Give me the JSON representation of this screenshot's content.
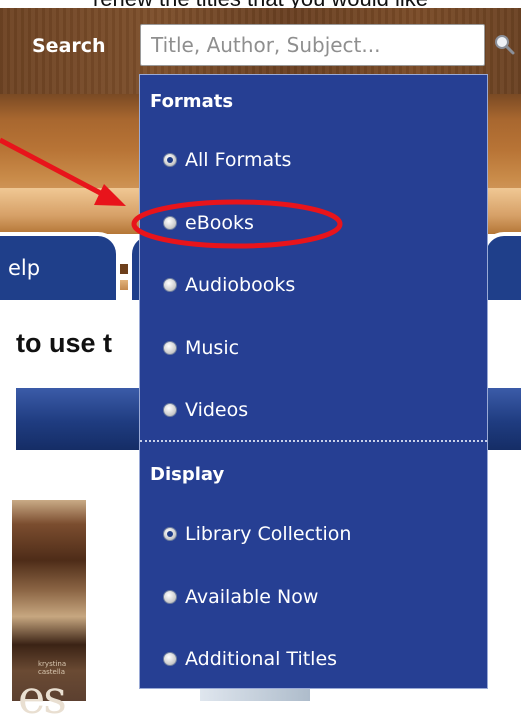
{
  "header": {
    "caption_fragment": "renew the titles that you would like",
    "search_label": "Search",
    "search_placeholder": "Title, Author, Subject..."
  },
  "nav": {
    "tab_help_label": "elp"
  },
  "main": {
    "heading": "to use t",
    "cover_letters": "es",
    "cover_author": "krystina castella"
  },
  "dropdown": {
    "formats": {
      "title": "Formats",
      "options": [
        {
          "label": "All Formats",
          "checked": true
        },
        {
          "label": "eBooks",
          "checked": false
        },
        {
          "label": "Audiobooks",
          "checked": false
        },
        {
          "label": "Music",
          "checked": false
        },
        {
          "label": "Videos",
          "checked": false
        }
      ]
    },
    "display": {
      "title": "Display",
      "options": [
        {
          "label": "Library Collection",
          "checked": true
        },
        {
          "label": "Available Now",
          "checked": false
        },
        {
          "label": "Additional Titles",
          "checked": false
        }
      ]
    }
  },
  "colors": {
    "dropdown_bg": "#263f93",
    "annotation_red": "#e8141b",
    "wood_dark": "#6e4323"
  }
}
